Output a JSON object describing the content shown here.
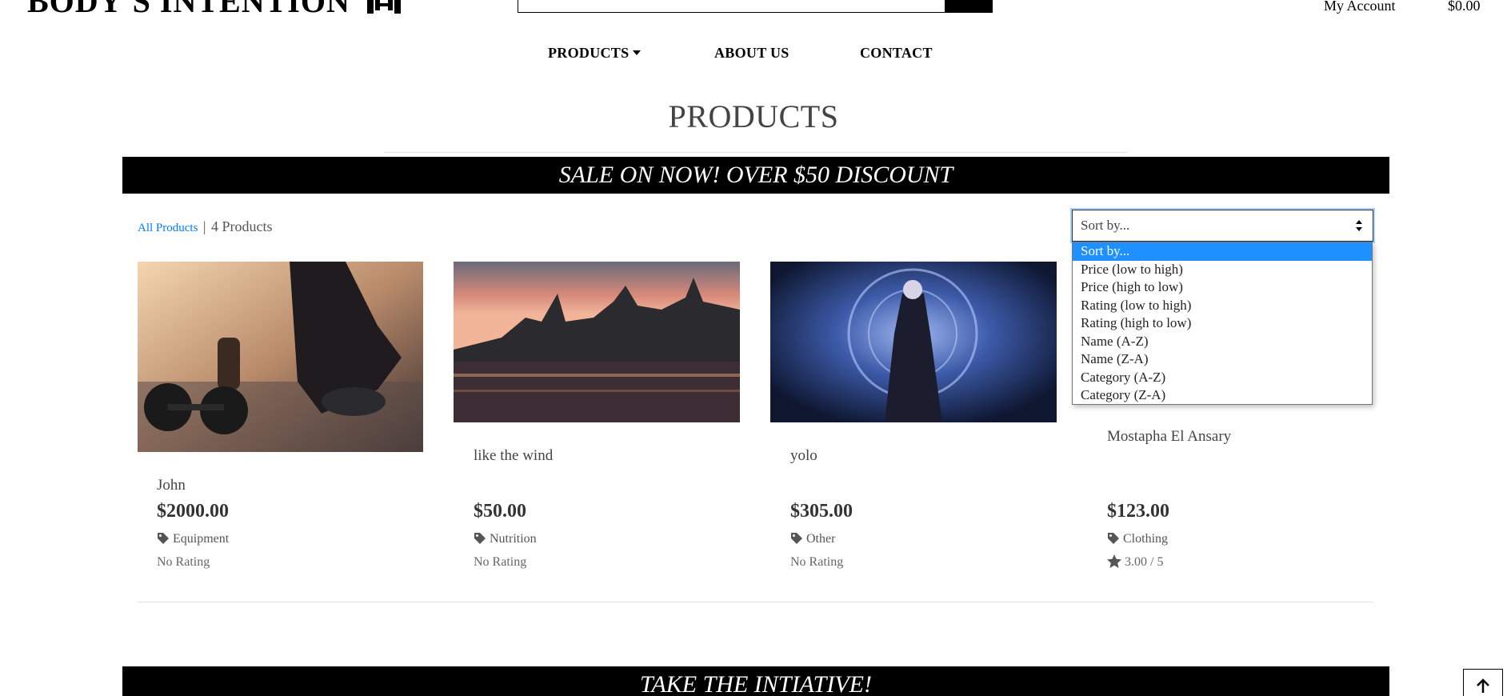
{
  "header": {
    "logo_text": "BODY'S INTENTION",
    "account_label": "My Account",
    "cart_total": "$0.00",
    "search": {
      "value": "",
      "placeholder": ""
    }
  },
  "nav": {
    "products": "PRODUCTS",
    "about": "ABOUT US",
    "contact": "CONTACT"
  },
  "page": {
    "title": "PRODUCTS",
    "sale_banner": "SALE ON NOW! OVER $50 DISCOUNT",
    "bottom_banner": "TAKE THE INTIATIVE!"
  },
  "listing": {
    "crumb_all": "All Products",
    "separator": "|",
    "count_label": "4 Products"
  },
  "sort": {
    "selected": "Sort by...",
    "options": [
      "Sort by...",
      "Price (low to high)",
      "Price (high to low)",
      "Rating (low to high)",
      "Rating (high to low)",
      "Name (A-Z)",
      "Name (Z-A)",
      "Category (A-Z)",
      "Category (Z-A)"
    ]
  },
  "products": [
    {
      "name": "John",
      "price": "$2000.00",
      "category": "Equipment",
      "rating": "No Rating"
    },
    {
      "name": "like the wind",
      "price": "$50.00",
      "category": "Nutrition",
      "rating": "No Rating"
    },
    {
      "name": "yolo",
      "price": "$305.00",
      "category": "Other",
      "rating": "No Rating"
    },
    {
      "name": "Mostapha El Ansary",
      "price": "$123.00",
      "category": "Clothing",
      "rating": "3.00 / 5"
    }
  ],
  "colors": {
    "link": "#007bff",
    "selected_option": "#1e90ff",
    "banner_bg": "#000000",
    "banner_text": "#ffffff"
  },
  "icons": {
    "logo": "dumbbell-icon",
    "search": "search-icon",
    "category": "tag-icon",
    "rating": "star-icon",
    "dropdown": "sort-arrows-icon",
    "back_to_top": "arrow-up-icon"
  }
}
